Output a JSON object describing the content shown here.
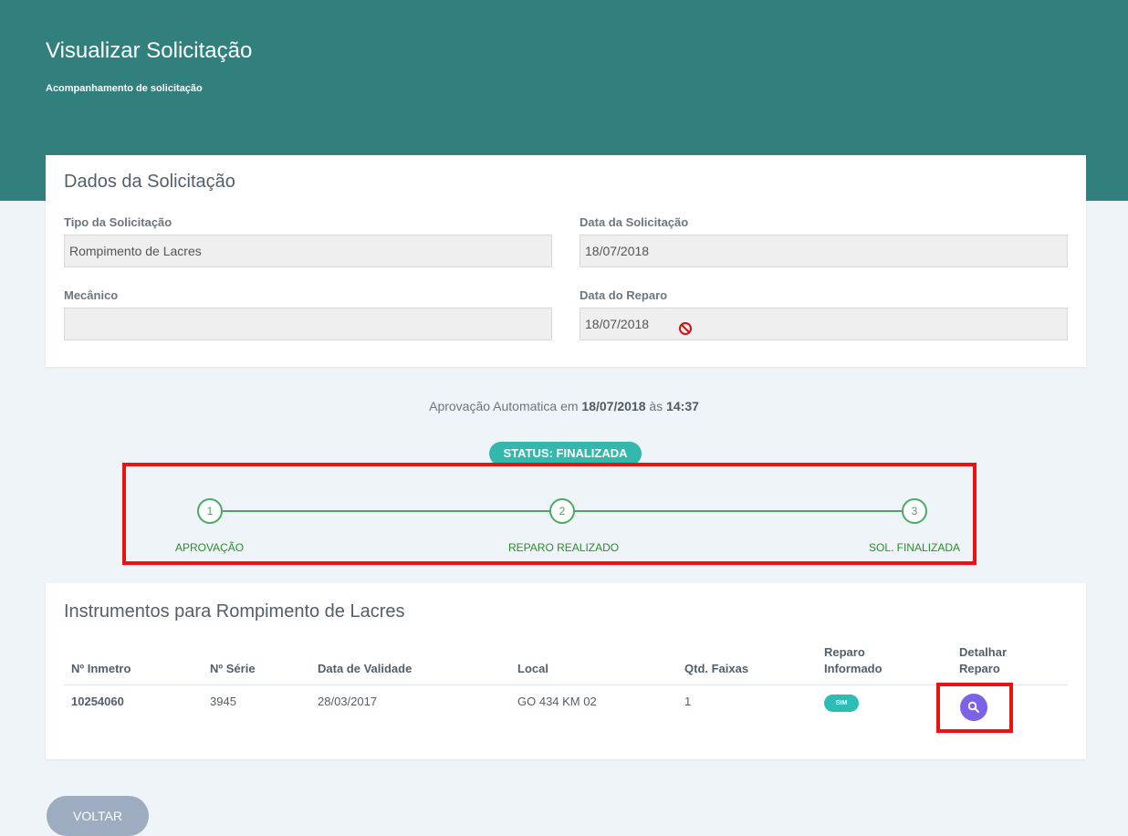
{
  "header": {
    "title": "Visualizar Solicitação",
    "subtitle": "Acompanhamento de solicitação"
  },
  "request_data": {
    "title": "Dados da Solicitação",
    "tipo_label": "Tipo da Solicitação",
    "tipo_value": "Rompimento de Lacres",
    "data_solicitacao_label": "Data da Solicitação",
    "data_solicitacao_value": "18/07/2018",
    "mecanico_label": "Mecânico",
    "mecanico_value": "",
    "data_reparo_label": "Data do Reparo",
    "data_reparo_value": "18/07/2018",
    "blocked_icon": "not-allowed-icon"
  },
  "approval": {
    "prefix": "Aprovação Automatica em",
    "date": "18/07/2018",
    "connector": "às",
    "time": "14:37"
  },
  "status": {
    "label": "STATUS: FINALIZADA"
  },
  "steps": [
    {
      "number": "1",
      "label": "APROVAÇÃO"
    },
    {
      "number": "2",
      "label": "REPARO REALIZADO"
    },
    {
      "number": "3",
      "label": "SOL. FINALIZADA"
    }
  ],
  "instruments": {
    "title": "Instrumentos para Rompimento de Lacres",
    "columns": [
      "Nº Inmetro",
      "Nº Série",
      "Data de Validade",
      "Local",
      "Qtd. Faixas",
      "Reparo Informado",
      "Detalhar Reparo"
    ],
    "rows": [
      {
        "inmetro": "10254060",
        "serie": "3945",
        "validade": "28/03/2017",
        "local": "GO 434 KM 02",
        "faixas": "1",
        "reparo_informado": "SIM",
        "detail_icon": "search-icon"
      }
    ]
  },
  "actions": {
    "back_label": "VOLTAR"
  },
  "colors": {
    "header_bg": "#31807e",
    "page_bg": "#eef4f7",
    "status_teal": "#34b8ae",
    "step_green": "#4aaa64",
    "highlight_red": "#ee1111",
    "detail_purple": "#7d62e6",
    "back_button": "#9eacc1"
  }
}
